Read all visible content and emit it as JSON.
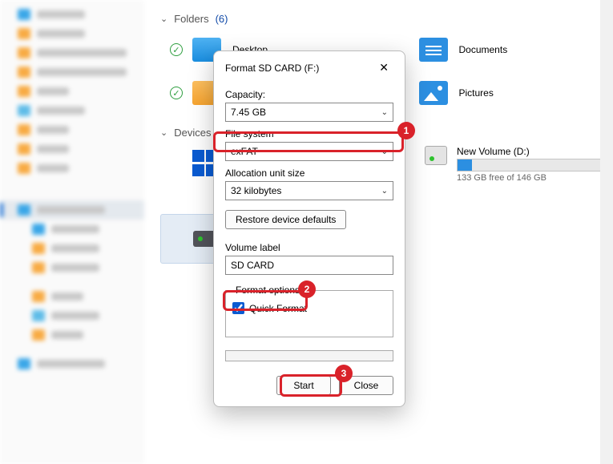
{
  "main": {
    "folders_section": {
      "label": "Folders",
      "count_text": "(6)"
    },
    "folder_items": {
      "desktop": "Desktop",
      "documents": "Documents",
      "pictures": "Pictures"
    },
    "devices_section": {
      "label": "Devices"
    },
    "new_volume": {
      "title": "New Volume (D:)",
      "sub": "133 GB free of 146 GB"
    }
  },
  "dialog": {
    "title": "Format SD CARD (F:)",
    "capacity_label": "Capacity:",
    "capacity_value": "7.45 GB",
    "filesystem_label": "File system",
    "filesystem_value": "exFAT",
    "alloc_label": "Allocation unit size",
    "alloc_value": "32 kilobytes",
    "restore_btn": "Restore device defaults",
    "volume_label_label": "Volume label",
    "volume_label_value": "SD CARD",
    "format_options_legend": "Format options",
    "quick_format_label": "Quick Format",
    "start_btn": "Start",
    "close_btn": "Close"
  },
  "annotations": {
    "b1": "1",
    "b2": "2",
    "b3": "3"
  }
}
